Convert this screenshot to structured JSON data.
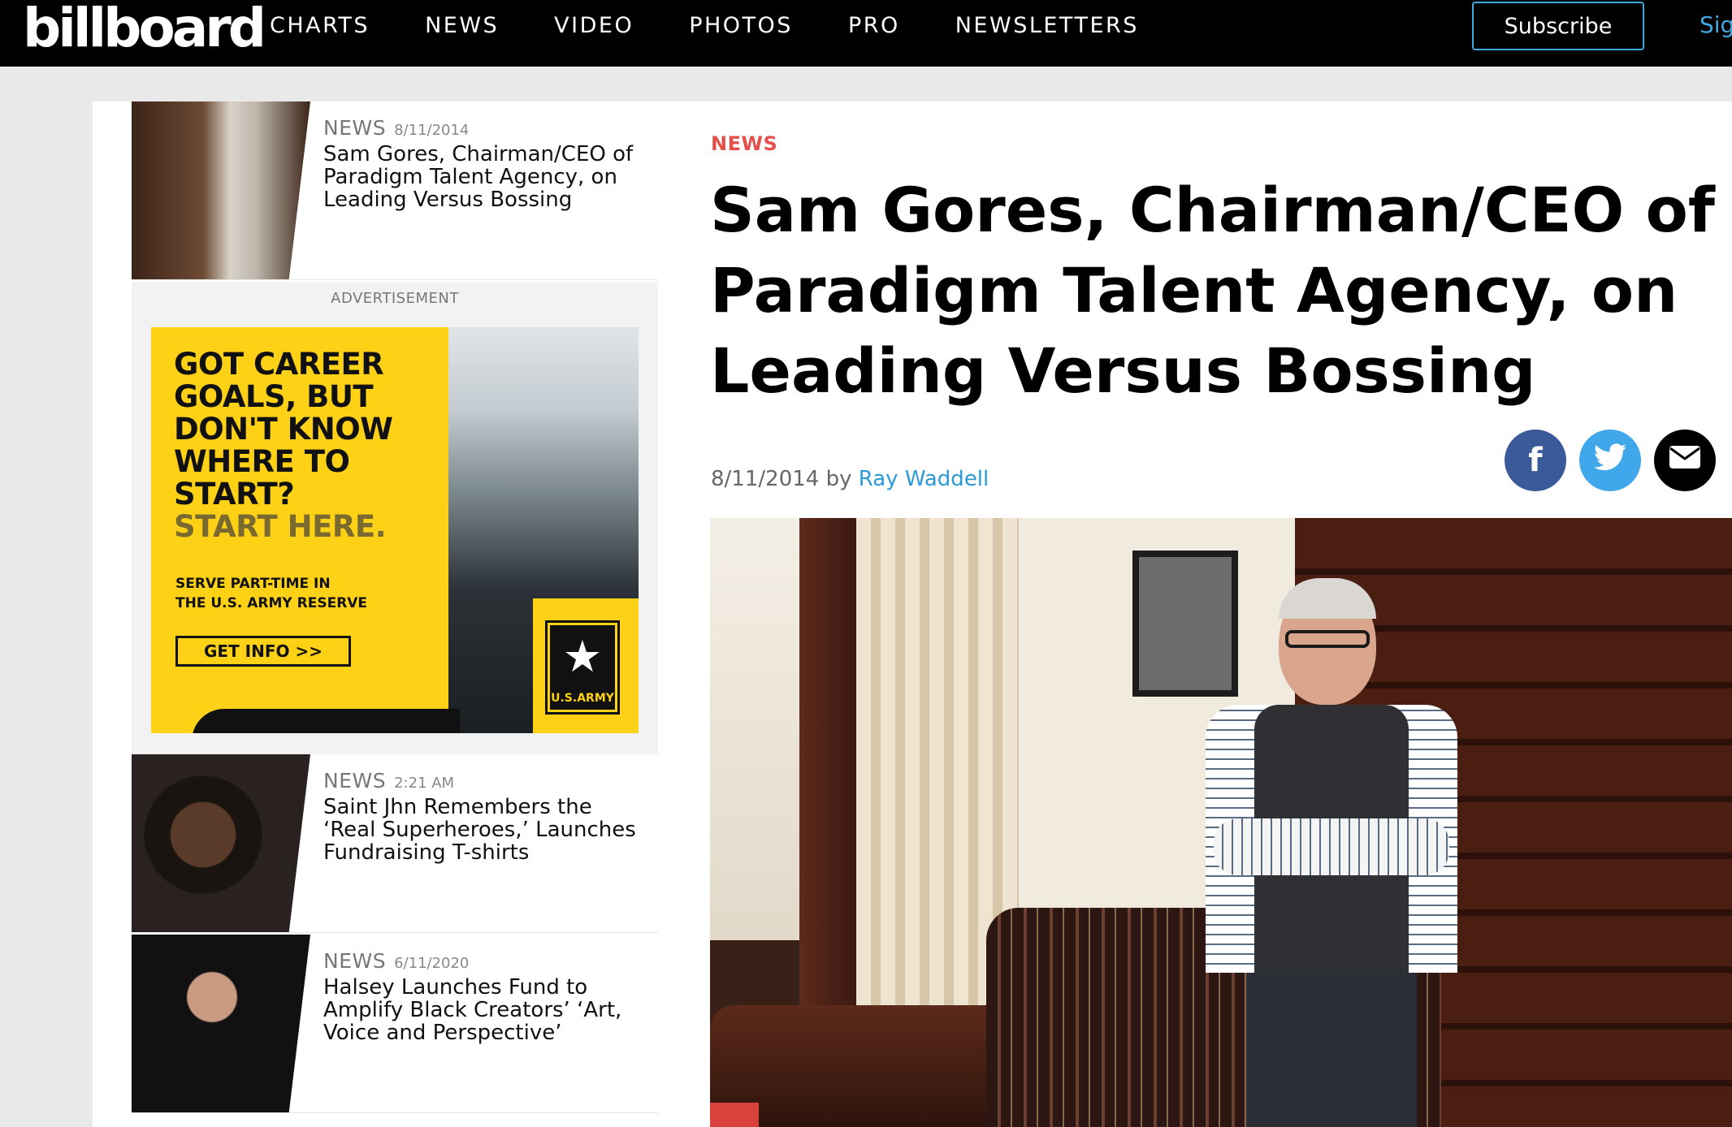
{
  "nav": {
    "logo": "billboard",
    "links": [
      "CHARTS",
      "NEWS",
      "VIDEO",
      "PHOTOS",
      "PRO",
      "NEWSLETTERS"
    ],
    "subscribe": "Subscribe",
    "signin": "Sig"
  },
  "sidebar": {
    "items": [
      {
        "category": "NEWS",
        "date": "8/11/2014",
        "headline": "Sam Gores, Chairman/CEO of Paradigm Talent Agency, on Leading Versus Bossing"
      },
      {
        "category": "NEWS",
        "date": "2:21 AM",
        "headline": "Saint Jhn Remembers the ‘Real Superheroes,’ Launches Fundraising T-shirts"
      },
      {
        "category": "NEWS",
        "date": "6/11/2020",
        "headline": "Halsey Launches Fund to Amplify Black Creators’ ‘Art, Voice and Perspective’"
      }
    ],
    "ad_label": "ADVERTISEMENT",
    "ad": {
      "headline_lines": [
        "GOT CAREER",
        "GOALS, BUT",
        "DON'T KNOW",
        "WHERE TO",
        "START?"
      ],
      "headline_alt": "START HERE.",
      "sub_lines": [
        "SERVE PART-TIME IN",
        "THE U.S. ARMY RESERVE"
      ],
      "button": "GET INFO >>",
      "badge": "U.S.ARMY"
    }
  },
  "article": {
    "kicker": "NEWS",
    "headline": "Sam Gores, Chairman/CEO of Paradigm Talent Agency, on Leading Versus Bossing",
    "date": "8/11/2014",
    "by": "by",
    "author": "Ray Waddell",
    "share": {
      "facebook": "f",
      "twitter": "🐦",
      "email": "✉"
    },
    "colors": {
      "kicker": "#e5504a",
      "author_link": "#2a9ad9",
      "facebook": "#3b5a9a",
      "twitter": "#40a7ea",
      "email": "#000000"
    }
  }
}
